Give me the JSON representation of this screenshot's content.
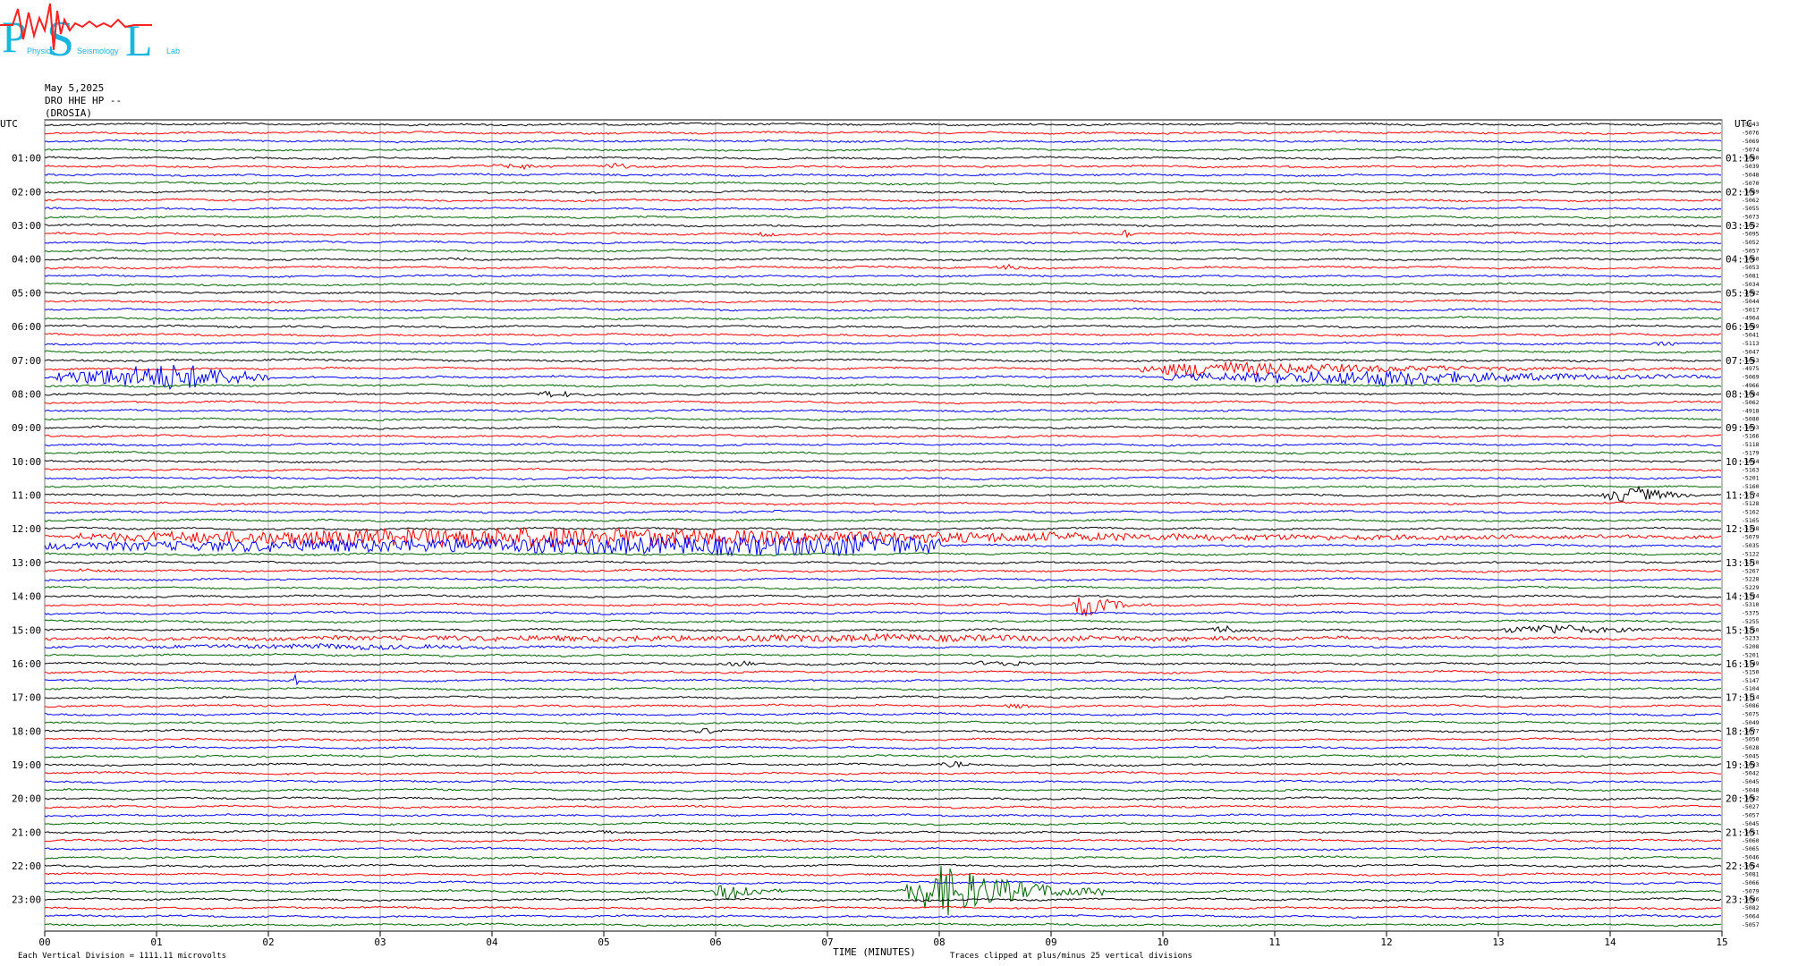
{
  "logo": {
    "letters": [
      "P",
      "S",
      "L"
    ],
    "words": [
      "Physics",
      "Seismology",
      "Lab"
    ],
    "colors": {
      "blue": "#1bb5e0",
      "red": "#ff2020"
    }
  },
  "header": {
    "date": "May 5,2025",
    "channel": "DRO HHE HP --",
    "station": "(DROSIA)"
  },
  "utc_label_left": "UTC",
  "utc_label_right": "UTC",
  "colors": {
    "trace": [
      "#000000",
      "#ff0000",
      "#0000ff",
      "#006400"
    ],
    "grid": "#999999"
  },
  "chart_data": {
    "type": "line",
    "title": "May 5,2025 DRO HHE HP -- (DROSIA)",
    "xlabel": "TIME (MINUTES)",
    "xlim": [
      0,
      15
    ],
    "x_ticks": [
      "00",
      "01",
      "02",
      "03",
      "04",
      "05",
      "06",
      "07",
      "08",
      "09",
      "10",
      "11",
      "12",
      "13",
      "14",
      "15"
    ],
    "rows": 96,
    "row_interval_minutes": 15,
    "left_hour_labels": [
      "01:00",
      "02:00",
      "03:00",
      "04:00",
      "05:00",
      "06:00",
      "07:00",
      "08:00",
      "09:00",
      "10:00",
      "11:00",
      "12:00",
      "13:00",
      "14:00",
      "15:00",
      "16:00",
      "17:00",
      "18:00",
      "19:00",
      "20:00",
      "21:00",
      "22:00",
      "23:00"
    ],
    "right_hour_labels": [
      "01:15",
      "02:15",
      "03:15",
      "04:15",
      "05:15",
      "06:15",
      "07:15",
      "08:15",
      "09:15",
      "10:15",
      "11:15",
      "12:15",
      "13:15",
      "14:15",
      "15:15",
      "16:15",
      "17:15",
      "18:15",
      "19:15",
      "20:15",
      "21:15",
      "22:15",
      "23:15"
    ],
    "row_offsets": [
      "-5043",
      "-5076",
      "-5069",
      "-5074",
      "-5060",
      "-5039",
      "-5048",
      "-5070",
      "-5069",
      "-5062",
      "-5055",
      "-5073",
      "-5052",
      "-5095",
      "-5052",
      "-5057",
      "-5060",
      "-5053",
      "-5081",
      "-5034",
      "-4982",
      "-5044",
      "-5017",
      "-4964",
      "-5089",
      "-5041",
      "-5113",
      "-5047",
      "-5063",
      "-4975",
      "-5069",
      "-4966",
      "-5084",
      "-5062",
      "-4918",
      "-5080",
      "-5093",
      "-5166",
      "-5118",
      "-5179",
      "-5034",
      "-5163",
      "-5201",
      "-5160",
      "-5174",
      "-5128",
      "-5162",
      "-5165",
      "-5138",
      "-5079",
      "-5035",
      "-5122",
      "-5210",
      "-5267",
      "-5228",
      "-5229",
      "-5334",
      "-5310",
      "-5375",
      "-5255",
      "-5250",
      "-5233",
      "-5208",
      "-5201",
      "-5149",
      "-5150",
      "-5147",
      "-5104",
      "-5114",
      "-5086",
      "-5075",
      "-5049",
      "-5077",
      "-5050",
      "-5028",
      "-5045",
      "-5033",
      "-5042",
      "-5045",
      "-5048",
      "-5062",
      "-5027",
      "-5057",
      "-5045",
      "-5051",
      "-5060",
      "-5065",
      "-5046",
      "-5054",
      "-5081",
      "-5066",
      "-5079",
      "-5046",
      "-5082",
      "-5064",
      "-5057"
    ],
    "footer_scale": "Each Vertical Division = 1111.11 microvolts",
    "footer_clip": "Traces clipped at plus/minus 25 vertical divisions",
    "events": [
      {
        "row": 5,
        "start_min": 3.9,
        "end_min": 4.7,
        "amp": 3
      },
      {
        "row": 5,
        "start_min": 4.95,
        "end_min": 5.3,
        "amp": 4
      },
      {
        "row": 13,
        "start_min": 6.3,
        "end_min": 6.6,
        "amp": 3
      },
      {
        "row": 13,
        "start_min": 9.6,
        "end_min": 9.75,
        "amp": 5
      },
      {
        "row": 16,
        "start_min": 3.6,
        "end_min": 3.9,
        "amp": 3
      },
      {
        "row": 17,
        "start_min": 8.5,
        "end_min": 8.8,
        "amp": 4
      },
      {
        "row": 26,
        "start_min": 14.3,
        "end_min": 14.7,
        "amp": 3
      },
      {
        "row": 29,
        "start_min": 9.8,
        "end_min": 15.0,
        "amp": 9,
        "peak": 10.3
      },
      {
        "row": 30,
        "start_min": 0.1,
        "end_min": 2.0,
        "amp": 16,
        "peak": 1.2
      },
      {
        "row": 30,
        "start_min": 10.0,
        "end_min": 15.0,
        "amp": 9,
        "peak": 12.0
      },
      {
        "row": 32,
        "start_min": 4.4,
        "end_min": 4.8,
        "amp": 5
      },
      {
        "row": 44,
        "start_min": 13.9,
        "end_min": 14.8,
        "amp": 10,
        "peak": 14.2
      },
      {
        "row": 49,
        "start_min": 0.2,
        "end_min": 15.0,
        "amp": 12,
        "peak": 4.4
      },
      {
        "row": 50,
        "start_min": 0.0,
        "end_min": 8.0,
        "amp": 12,
        "peak": 7.2
      },
      {
        "row": 53,
        "start_min": 0.0,
        "end_min": 1.0,
        "amp": 2
      },
      {
        "row": 57,
        "start_min": 9.2,
        "end_min": 9.9,
        "amp": 14,
        "peak": 9.3
      },
      {
        "row": 60,
        "start_min": 10.4,
        "end_min": 10.8,
        "amp": 5
      },
      {
        "row": 60,
        "start_min": 13.0,
        "end_min": 14.8,
        "amp": 6,
        "peak": 13.5
      },
      {
        "row": 61,
        "start_min": 0.0,
        "end_min": 15.0,
        "amp": 4
      },
      {
        "row": 62,
        "start_min": 0.5,
        "end_min": 5.2,
        "amp": 3
      },
      {
        "row": 64,
        "start_min": 6.1,
        "end_min": 6.4,
        "amp": 4
      },
      {
        "row": 64,
        "start_min": 8.3,
        "end_min": 8.9,
        "amp": 4
      },
      {
        "row": 66,
        "start_min": 2.2,
        "end_min": 2.3,
        "amp": 8
      },
      {
        "row": 69,
        "start_min": 8.5,
        "end_min": 8.9,
        "amp": 3
      },
      {
        "row": 72,
        "start_min": 5.8,
        "end_min": 6.1,
        "amp": 4
      },
      {
        "row": 76,
        "start_min": 8.0,
        "end_min": 8.3,
        "amp": 4
      },
      {
        "row": 84,
        "start_min": 4.9,
        "end_min": 5.2,
        "amp": 2
      },
      {
        "row": 91,
        "start_min": 6.0,
        "end_min": 6.6,
        "amp": 13,
        "peak": 6.15
      },
      {
        "row": 91,
        "start_min": 7.7,
        "end_min": 9.5,
        "amp": 30,
        "peak": 8.05
      }
    ]
  }
}
